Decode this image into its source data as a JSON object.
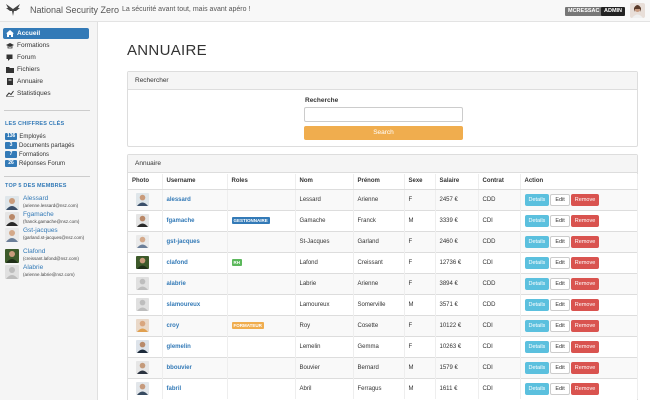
{
  "app": {
    "brand": "National Security Zero",
    "tagline": "La sécurité avant tout, mais avant apéro !",
    "user": "MCRESSAC",
    "role": "ADMIN"
  },
  "nav": [
    {
      "label": "Accueil",
      "icon": "home-icon",
      "active": true
    },
    {
      "label": "Formations",
      "icon": "graduation-cap-icon"
    },
    {
      "label": "Forum",
      "icon": "chat-icon"
    },
    {
      "label": "Fichiers",
      "icon": "folder-icon"
    },
    {
      "label": "Annuaire",
      "icon": "phonebook-icon"
    },
    {
      "label": "Statistiques",
      "icon": "chart-icon"
    }
  ],
  "stats": {
    "heading": "LES CHIFFRES CLÉS",
    "items": [
      {
        "count": "136",
        "label": "Employés"
      },
      {
        "count": "3",
        "label": "Documents partagés"
      },
      {
        "count": "7",
        "label": "Formations"
      },
      {
        "count": "26",
        "label": "Réponses Forum"
      }
    ]
  },
  "members": {
    "heading": "TOP 5 DES MEMBRES",
    "items": [
      {
        "name": "Alessard",
        "email": "(arienne.lessard@nsz.com)"
      },
      {
        "name": "Fgamache",
        "email": "(franck.gamache@nsz.com)"
      },
      {
        "name": "Gst-jacques",
        "email": "(garland.st-jacques@nsz.com)"
      },
      {
        "name": "Clafond",
        "email": "(creissant.lafond@nsz.com)"
      },
      {
        "name": "Alabrie",
        "email": "(arienne.labrie@nsz.com)"
      }
    ]
  },
  "page": {
    "title": "ANNUAIRE"
  },
  "search": {
    "panel_title": "Rechercher",
    "label": "Recherche",
    "value": "",
    "button": "Search"
  },
  "directory": {
    "panel_title": "Annuaire",
    "columns": [
      "Photo",
      "Username",
      "Roles",
      "Nom",
      "Prénom",
      "Sexe",
      "Salaire",
      "Contrat",
      "Action"
    ],
    "actions": {
      "details": "Details",
      "edit": "Edit",
      "remove": "Remove"
    },
    "role_colors": {
      "GESTIONNAIRE": "#337ab7",
      "RH": "#5cb85c",
      "FORMATEUR": "#f0ad4e"
    },
    "rows": [
      {
        "username": "alessard",
        "role": "",
        "nom": "Lessard",
        "prenom": "Arienne",
        "sexe": "F",
        "salaire": "2457 €",
        "contrat": "CDD"
      },
      {
        "username": "fgamache",
        "role": "GESTIONNAIRE",
        "nom": "Gamache",
        "prenom": "Franck",
        "sexe": "M",
        "salaire": "3339 €",
        "contrat": "CDI"
      },
      {
        "username": "gst-jacques",
        "role": "",
        "nom": "St-Jacques",
        "prenom": "Garland",
        "sexe": "F",
        "salaire": "2460 €",
        "contrat": "CDD"
      },
      {
        "username": "clafond",
        "role": "RH",
        "nom": "Lafond",
        "prenom": "Creissant",
        "sexe": "F",
        "salaire": "12736 €",
        "contrat": "CDI"
      },
      {
        "username": "alabrie",
        "role": "",
        "nom": "Labrie",
        "prenom": "Arienne",
        "sexe": "F",
        "salaire": "3894 €",
        "contrat": "CDD"
      },
      {
        "username": "slamoureux",
        "role": "",
        "nom": "Lamoureux",
        "prenom": "Somerville",
        "sexe": "M",
        "salaire": "3571 €",
        "contrat": "CDD"
      },
      {
        "username": "croy",
        "role": "FORMATEUR",
        "nom": "Roy",
        "prenom": "Cosette",
        "sexe": "F",
        "salaire": "10122 €",
        "contrat": "CDI"
      },
      {
        "username": "glemelin",
        "role": "",
        "nom": "Lemelin",
        "prenom": "Gemma",
        "sexe": "F",
        "salaire": "10263 €",
        "contrat": "CDI"
      },
      {
        "username": "bbouvier",
        "role": "",
        "nom": "Bouvier",
        "prenom": "Bernard",
        "sexe": "M",
        "salaire": "1579 €",
        "contrat": "CDI"
      },
      {
        "username": "fabril",
        "role": "",
        "nom": "Abril",
        "prenom": "Ferragus",
        "sexe": "M",
        "salaire": "1611 €",
        "contrat": "CDI"
      }
    ]
  }
}
